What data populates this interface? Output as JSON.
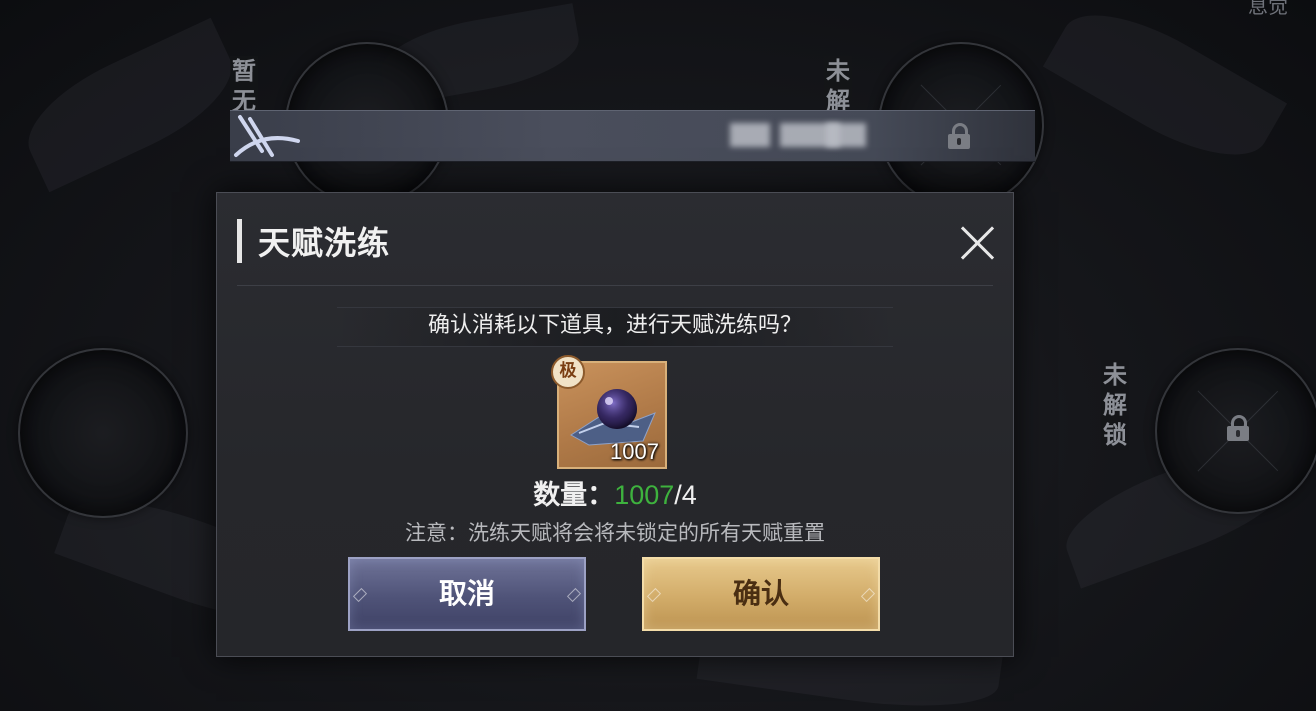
{
  "background": {
    "top_right_label": "息觉",
    "left_slot_label": "暂无",
    "right_top_slot_label": "未解",
    "right_mid_slot_label": "未解锁"
  },
  "dialog": {
    "title": "天赋洗练",
    "prompt": "确认消耗以下道具，进行天赋洗练吗？",
    "item": {
      "grade_badge": "极",
      "count": "1007",
      "icon": "talent-orb-icon"
    },
    "quantity": {
      "label": "数量：",
      "have": "1007",
      "need": "/4",
      "have_color": "#3eb23e"
    },
    "note": "注意：洗练天赋将会将未锁定的所有天赋重置",
    "buttons": {
      "cancel": "取消",
      "confirm": "确认"
    }
  },
  "colors": {
    "cancel_button": "#4f5378",
    "confirm_button": "#d2ac69",
    "dialog_bg": "#2b2c31"
  }
}
